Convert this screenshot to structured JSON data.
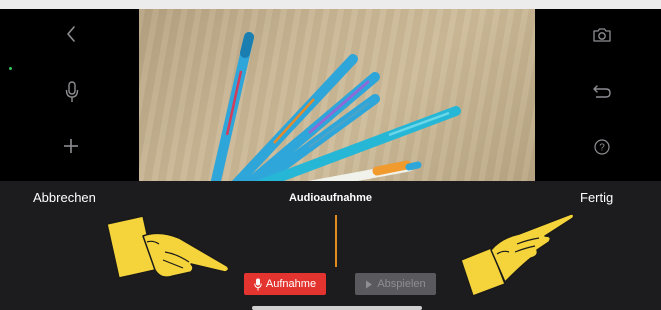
{
  "colors": {
    "accent_record": "#e3342f",
    "playhead": "#e08a1e",
    "panel_bg": "#1c1c1e",
    "hand_fill": "#f5d33b",
    "rail_icon": "#8e8e93"
  },
  "left_rail": {
    "icons": [
      "chevron-left-icon",
      "microphone-icon",
      "plus-icon"
    ]
  },
  "right_rail": {
    "icons": [
      "camera-icon",
      "undo-icon",
      "help-icon"
    ]
  },
  "preview": {
    "pens": [
      "blue-red-pen",
      "blue-orange-pen",
      "blue-purple-pen",
      "blue-teal-pen",
      "blue-pen",
      "orange-white-pen"
    ]
  },
  "panel": {
    "cancel_label": "Abbrechen",
    "title": "Audioaufnahme",
    "done_label": "Fertig",
    "record_label": "Aufnahme",
    "play_label": "Abspielen"
  },
  "annotations": {
    "left_hand": "pointing-hand-icon",
    "right_hand": "pointing-hand-icon"
  }
}
